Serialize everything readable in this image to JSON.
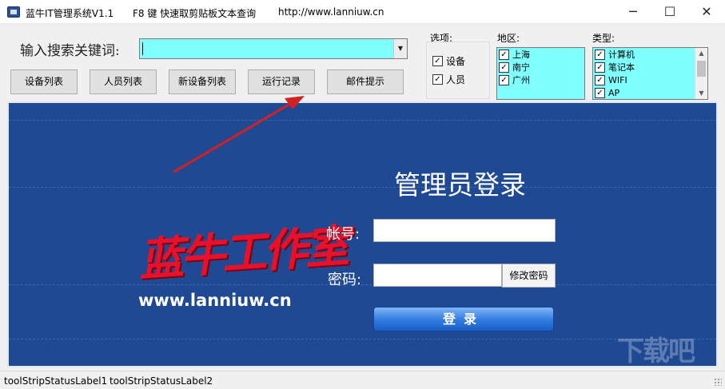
{
  "window": {
    "title": "蓝牛IT管理系统V1.1",
    "hotkey_hint": "F8 键 快速取剪贴板文本查询",
    "url": "http://www.lanniuw.cn",
    "minimize_glyph": "─",
    "maximize_glyph": "☐",
    "close_glyph": "✕"
  },
  "search": {
    "label": "输入搜索关键词:",
    "value": "",
    "dropdown_glyph": "▼"
  },
  "toolbar": {
    "buttons": [
      "设备列表",
      "人员列表",
      "新设备列表",
      "运行记录",
      "邮件提示"
    ]
  },
  "options": {
    "label": "选项:",
    "items": [
      {
        "label": "设备",
        "checked": true
      },
      {
        "label": "人员",
        "checked": true
      }
    ]
  },
  "region": {
    "label": "地区:",
    "items": [
      {
        "label": "上海",
        "checked": true
      },
      {
        "label": "南宁",
        "checked": true
      },
      {
        "label": "广州",
        "checked": true
      }
    ]
  },
  "type": {
    "label": "类型:",
    "items": [
      {
        "label": "计算机",
        "checked": true
      },
      {
        "label": "笔记本",
        "checked": true
      },
      {
        "label": "WIFI",
        "checked": true
      },
      {
        "label": "AP",
        "checked": true
      }
    ],
    "scroll_up_glyph": "▲",
    "scroll_down_glyph": "▼"
  },
  "login": {
    "title": "管理员登录",
    "account_label": "帐号:",
    "account_value": "",
    "password_label": "密码:",
    "password_value": "",
    "change_password_label": "修改密码",
    "login_button_label": "登录"
  },
  "branding": {
    "logo_text": "蓝牛工作室",
    "logo_url": "www.lanniuw.cn",
    "watermark": "下载吧"
  },
  "status": {
    "label1": "toolStripStatusLabel1",
    "label2": "toolStripStatusLabel2"
  },
  "colors": {
    "panel_bg": "#1f4a93",
    "input_cyan": "#80ffff",
    "logo_red": "#e8102a",
    "annotation_arrow": "#d42020"
  },
  "check_glyph": "✓"
}
